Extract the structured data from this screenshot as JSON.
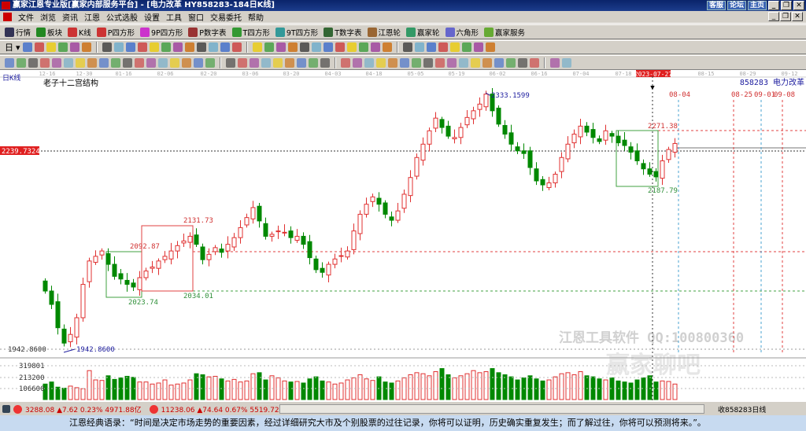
{
  "window": {
    "title": "赢家江恩专业版[赢家内部服务平台] - [电力改革   HY858283-184日K线]",
    "links": [
      "客服",
      "论坛",
      "主页"
    ]
  },
  "menu": [
    "文件",
    "浏览",
    "资讯",
    "江恩",
    "公式选股",
    "设置",
    "工具",
    "窗口",
    "交易委托",
    "帮助"
  ],
  "toolbar1": [
    {
      "label": "行情",
      "icon": "market-icon",
      "color": "#335"
    },
    {
      "label": "板块",
      "icon": "sector-icon",
      "color": "#282"
    },
    {
      "label": "K线",
      "icon": "kline-icon",
      "color": "#c33"
    },
    {
      "label": "P四方形",
      "icon": "ps-icon",
      "color": "#c33"
    },
    {
      "label": "9P四方形",
      "icon": "p9-icon",
      "color": "#c3c"
    },
    {
      "label": "P数字表",
      "icon": "pn-icon",
      "color": "#933"
    },
    {
      "label": "T四方形",
      "icon": "ts-icon",
      "color": "#393"
    },
    {
      "label": "9T四方形",
      "icon": "t9-icon",
      "color": "#399"
    },
    {
      "label": "T数字表",
      "icon": "tn-icon",
      "color": "#363"
    },
    {
      "label": "江恩轮",
      "icon": "gann-wheel-icon",
      "color": "#963"
    },
    {
      "label": "赢家轮",
      "icon": "winner-wheel-icon",
      "color": "#396"
    },
    {
      "label": "六角形",
      "icon": "hexagon-icon",
      "color": "#66c"
    },
    {
      "label": "赢家服务",
      "icon": "dollar-icon",
      "color": "#6a3"
    }
  ],
  "toolbar2_first": "日",
  "chart": {
    "period_label": "日K线",
    "indicator_title": "老子十二宫结构",
    "stock_label": "858283 电力改革",
    "date_ticks": [
      "12-16",
      "12-30",
      "01-16",
      "02-06",
      "02-20",
      "03-06",
      "03-20",
      "04-03",
      "04-18",
      "05-05",
      "05-19",
      "06-02",
      "06-16",
      "07-04",
      "07-18",
      "08-15",
      "08-29",
      "09-12"
    ],
    "cursor_date": "2023-07-27",
    "current_price_label": "2239.7324",
    "low_axis_label": "1942.8600",
    "future_dates": [
      "08-04",
      "08-25",
      "09-01",
      "09-08"
    ],
    "annotations": {
      "high": "2333.1599",
      "low": "1942.8600",
      "box1_top": "2092.87",
      "box1_bottom": "2023.74",
      "box2_top": "2131.73",
      "box2_bottom": "2034.01",
      "box3_top": "2271.38",
      "box3_bottom": "2187.79"
    },
    "volume_ticks": [
      "319801",
      "213200",
      "106600"
    ],
    "watermark": "江恩工具软件 QQ:100800360",
    "watermark2": "赢家聊吧",
    "colors": {
      "up": "#e03030",
      "down": "#008800",
      "axis_blue": "#2020a0"
    }
  },
  "chart_data": {
    "type": "candlestick",
    "ylim": [
      1942.86,
      2333.16
    ],
    "closes": [
      2030,
      2010,
      1975,
      1952,
      1965,
      1990,
      2040,
      2075,
      2082,
      2090,
      2070,
      2052,
      2048,
      2040,
      2036,
      2050,
      2060,
      2066,
      2075,
      2082,
      2090,
      2098,
      2105,
      2112,
      2100,
      2077,
      2085,
      2095,
      2088,
      2100,
      2110,
      2125,
      2140,
      2155,
      2135,
      2112,
      2115,
      2120,
      2118,
      2110,
      2112,
      2100,
      2080,
      2062,
      2058,
      2070,
      2078,
      2083,
      2090,
      2120,
      2145,
      2160,
      2171,
      2160,
      2145,
      2136,
      2150,
      2175,
      2200,
      2230,
      2250,
      2270,
      2289,
      2275,
      2262,
      2260,
      2275,
      2290,
      2300,
      2310,
      2325,
      2300,
      2280,
      2265,
      2250,
      2240,
      2236,
      2215,
      2195,
      2189,
      2192,
      2205,
      2230,
      2250,
      2265,
      2277,
      2268,
      2260,
      2254,
      2270,
      2262,
      2252,
      2248,
      2238,
      2225,
      2213,
      2205,
      2201,
      2225,
      2242,
      2251
    ],
    "volumes": [
      150000,
      170000,
      120000,
      110000,
      130000,
      115000,
      105000,
      280000,
      190000,
      185000,
      230000,
      195000,
      210000,
      225000,
      215000,
      170000,
      170000,
      150000,
      160000,
      190000,
      140000,
      150000,
      160000,
      190000,
      250000,
      240000,
      220000,
      225000,
      200000,
      180000,
      195000,
      170000,
      180000,
      250000,
      260000,
      190000,
      230000,
      210000,
      180000,
      170000,
      175000,
      160000,
      200000,
      220000,
      180000,
      170000,
      150000,
      160000,
      190000,
      210000,
      240000,
      200000,
      185000,
      220000,
      170000,
      160000,
      180000,
      210000,
      240000,
      260000,
      250000,
      230000,
      270000,
      300000,
      240000,
      210000,
      230000,
      250000,
      280000,
      260000,
      270000,
      300000,
      260000,
      240000,
      220000,
      190000,
      210000,
      230000,
      200000,
      180000,
      190000,
      220000,
      250000,
      260000,
      240000,
      270000,
      230000,
      220000,
      200000,
      190000,
      210000,
      180000,
      170000,
      160000,
      190000,
      210000,
      230000,
      170000,
      180000,
      175000,
      150000
    ]
  },
  "status": {
    "sh": "3288.08 ▲7.62 0.23% 4971.88亿",
    "sz": "11238.06 ▲74.64 0.67% 5519.72亿",
    "right": "收858283日线"
  },
  "quote": "江恩经典语录：“时间是决定市场走势的重要因素，经过详细研究大市及个别股票的过往记录，你将可以证明，历史确实重复发生；而了解过往，你将可以预测将来。”。"
}
